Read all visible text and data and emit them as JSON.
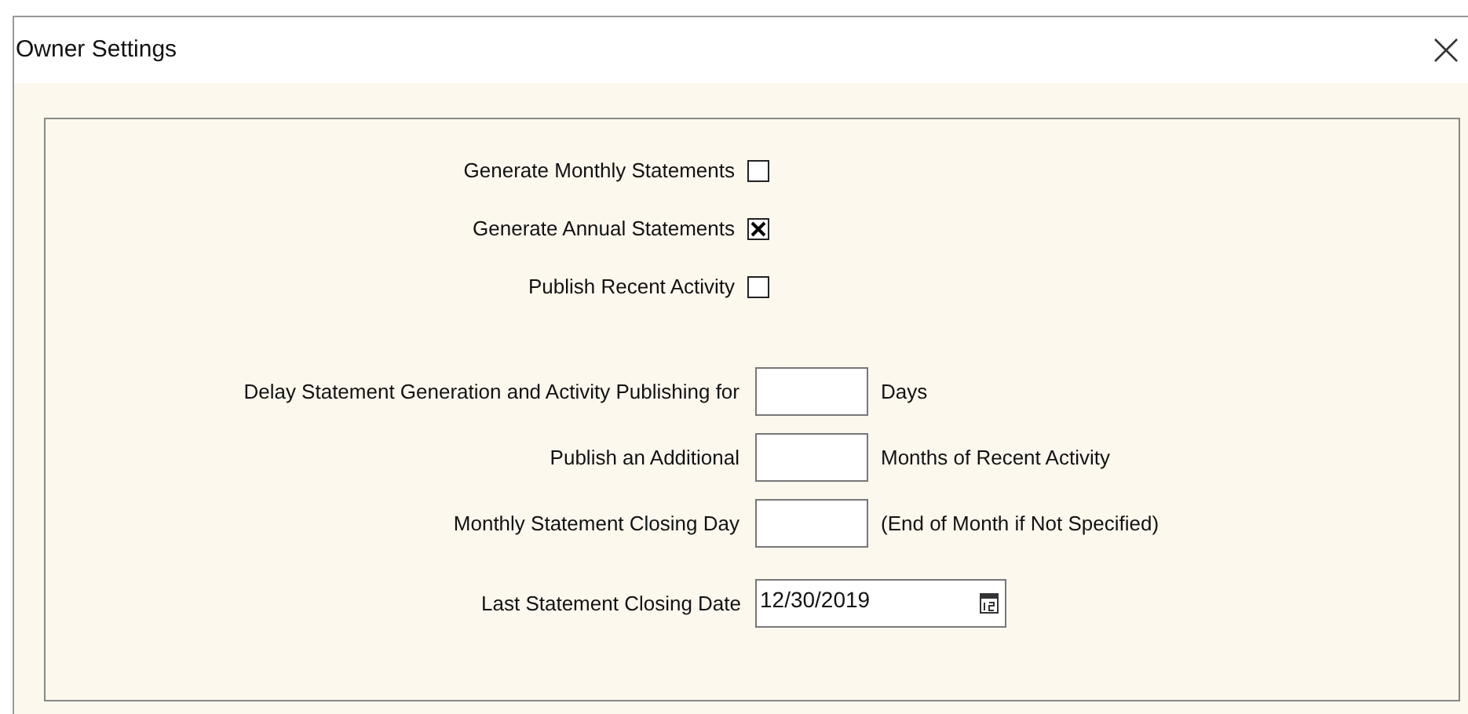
{
  "window": {
    "title": "Owner Settings"
  },
  "checkboxes": [
    {
      "label": "Generate Monthly Statements",
      "checked": false
    },
    {
      "label": "Generate Annual Statements",
      "checked": true
    },
    {
      "label": "Publish Recent Activity",
      "checked": false
    }
  ],
  "fields": [
    {
      "label": "Delay Statement Generation and Activity Publishing for",
      "suffix": "Days"
    },
    {
      "label": "Publish an Additional",
      "suffix": "Months of Recent Activity"
    },
    {
      "label": "Monthly Statement Closing Day",
      "suffix": "(End of Month if Not Specified)"
    }
  ],
  "date_field": {
    "label": "Last Statement Closing Date",
    "value": "12/30/2019"
  }
}
